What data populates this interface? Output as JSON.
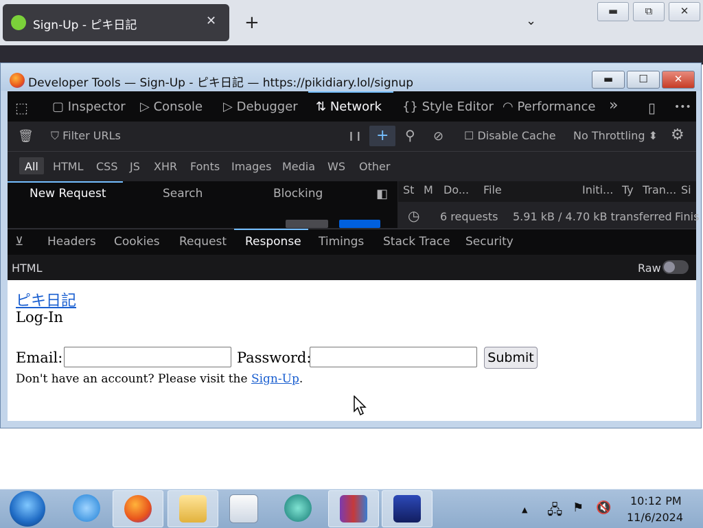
{
  "browser": {
    "tab_title": "Sign-Up - ピキ日記",
    "tab_close": "✕",
    "new_tab": "+",
    "tab_list": "⌄",
    "window_buttons": {
      "minimize": "▬",
      "maximize": "⧉",
      "close": "✕"
    }
  },
  "devtools": {
    "window_title": "Developer Tools — Sign-Up - ピキ日記 — https://pikidiary.lol/signup",
    "window_buttons": {
      "minimize": "▬",
      "maximize": "☐",
      "close": "✕"
    },
    "toolbar": {
      "picker_icon": "⬚",
      "inspector": "Inspector",
      "console": "Console",
      "debugger": "Debugger",
      "network": "Network",
      "style_editor": "Style Editor",
      "performance": "Performance",
      "overflow": "»",
      "responsive_icon": "▯",
      "more": "•••"
    },
    "filter": {
      "trash_icon": "🗑",
      "placeholder": "Filter URLs",
      "pause": "❙❙",
      "add": "+",
      "search_icon": "⚲",
      "block_icon": "⊘",
      "disable_cache": "Disable Cache",
      "throttling": "No Throttling ⬍",
      "settings_icon": "⚙"
    },
    "types": [
      "All",
      "HTML",
      "CSS",
      "JS",
      "XHR",
      "Fonts",
      "Images",
      "Media",
      "WS",
      "Other"
    ],
    "request_tabs": {
      "new_request": "New Request",
      "search": "Search",
      "blocking": "Blocking"
    },
    "columns": [
      "St",
      "M",
      "Do...",
      "File",
      "Initi...",
      "Ty",
      "Tran...",
      "Si"
    ],
    "summary": {
      "timer_icon": "◷",
      "requests": "6 requests",
      "transferred": "5.91 kB / 4.70 kB transferred",
      "finish": "Finis"
    },
    "detail_tabs": [
      "Headers",
      "Cookies",
      "Request",
      "Response",
      "Timings",
      "Stack Trace",
      "Security"
    ],
    "html_label": "HTML",
    "raw_label": "Raw"
  },
  "preview": {
    "site_link": "ピキ日記",
    "heading": "Log-In",
    "email_label": "Email:",
    "password_label": "Password:",
    "submit": "Submit",
    "signup_text_before": "Don't have an account? Please visit the ",
    "signup_link": "Sign-Up",
    "signup_text_after": "."
  },
  "taskbar": {
    "time": "10:12 PM",
    "date": "11/6/2024",
    "tray_up": "▲"
  },
  "colors": {
    "accent": "#75bfff",
    "devtools_bg": "#232327",
    "link": "#1a5fd0"
  }
}
